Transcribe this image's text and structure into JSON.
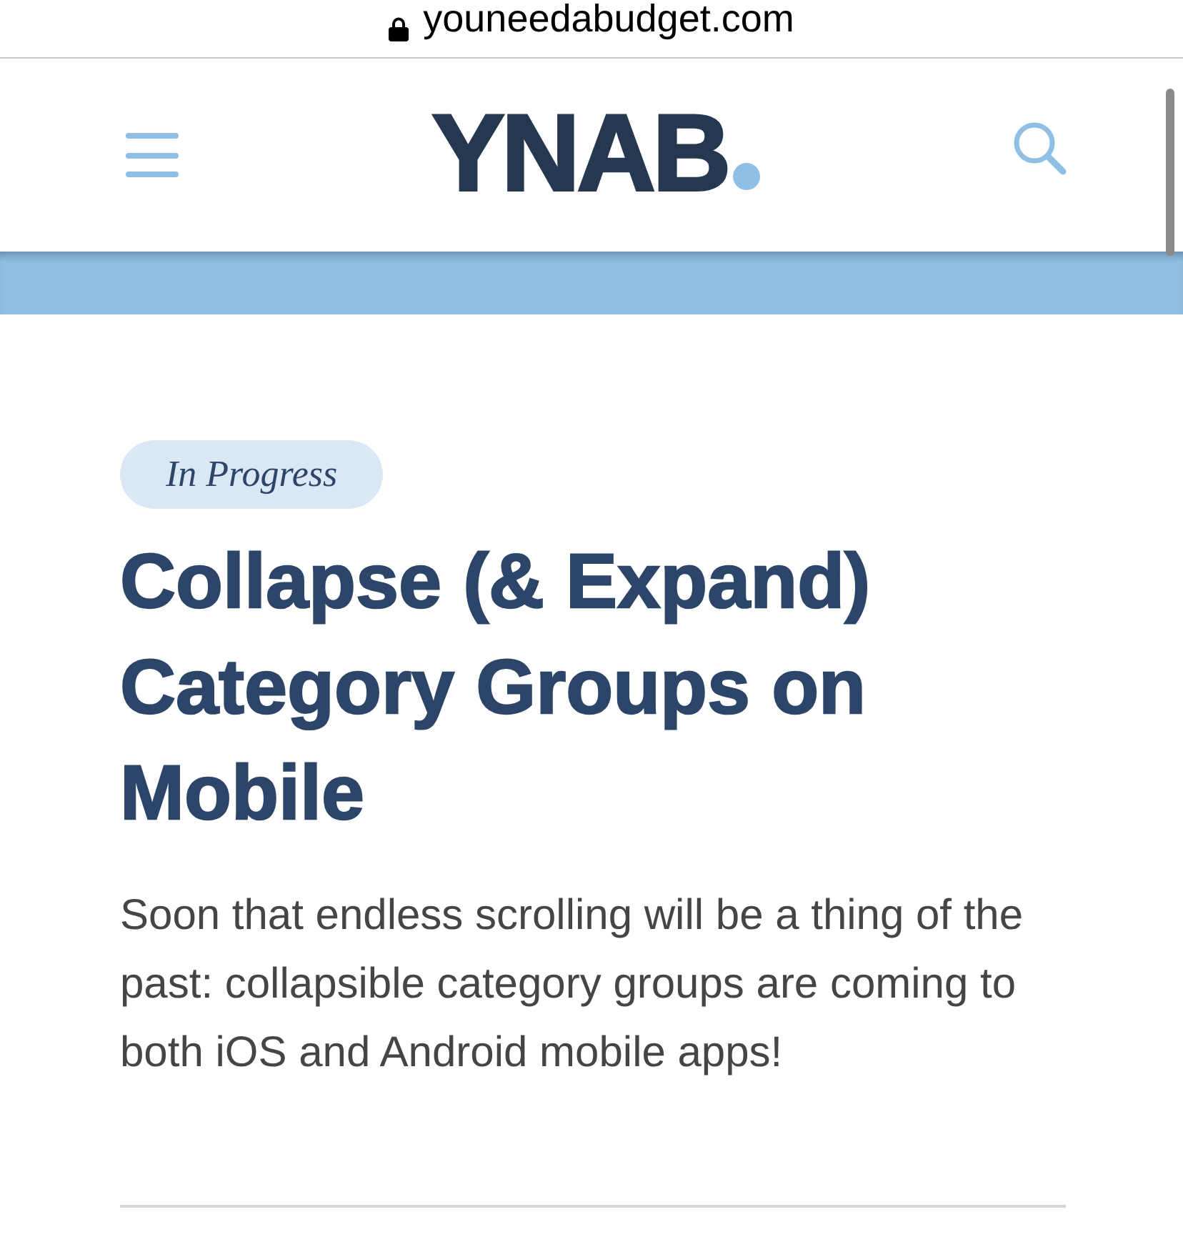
{
  "address_bar": {
    "url": "youneedabudget.com",
    "secure": true
  },
  "header": {
    "logo": "YNAB"
  },
  "article": {
    "status_badge": "In Progress",
    "title": "Collapse (& Expand) Category Groups on Mobile",
    "summary": "Soon that endless scrolling will be a thing of the past: collapsible category groups are coming to both iOS and Android mobile apps!"
  }
}
